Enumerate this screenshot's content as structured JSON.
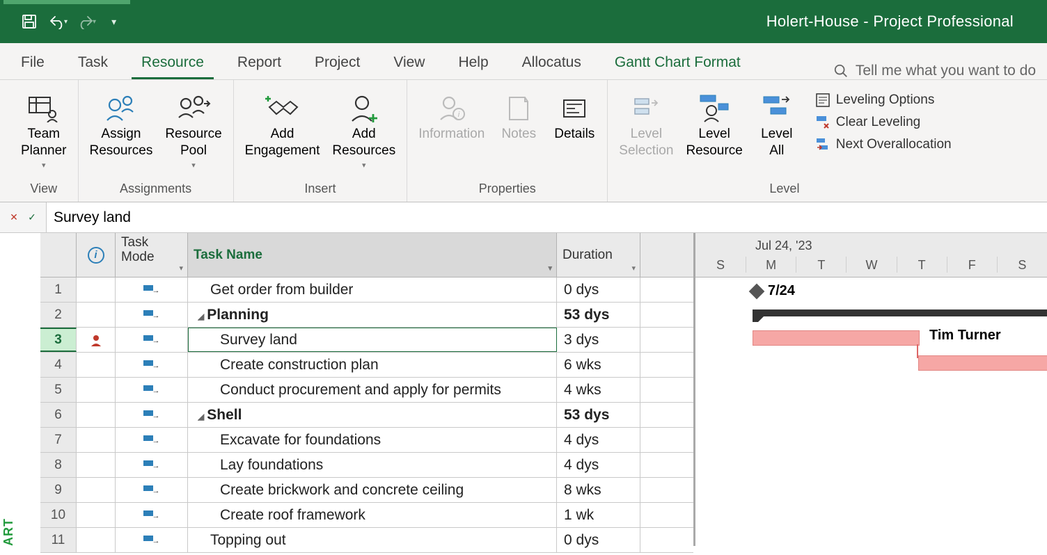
{
  "title": "Holert-House  -  Project Professional",
  "tabs": {
    "file": "File",
    "task": "Task",
    "resource": "Resource",
    "report": "Report",
    "project": "Project",
    "view": "View",
    "help": "Help",
    "allocatus": "Allocatus",
    "gantt_format": "Gantt Chart Format",
    "tell_me": "Tell me what you want to do"
  },
  "ribbon": {
    "team_planner": "Team\nPlanner",
    "assign_resources": "Assign\nResources",
    "resource_pool": "Resource\nPool",
    "add_engagement": "Add\nEngagement",
    "add_resources": "Add\nResources",
    "information": "Information",
    "notes": "Notes",
    "details": "Details",
    "level_selection": "Level\nSelection",
    "level_resource": "Level\nResource",
    "level_all": "Level\nAll",
    "leveling_options": "Leveling Options",
    "clear_leveling": "Clear Leveling",
    "next_overallocation": "Next Overallocation",
    "group_view": "View",
    "group_assignments": "Assignments",
    "group_insert": "Insert",
    "group_properties": "Properties",
    "group_level": "Level"
  },
  "formula_value": "Survey land",
  "columns": {
    "task_mode": "Task\nMode",
    "task_name": "Task Name",
    "duration": "Duration"
  },
  "rows": [
    {
      "num": "1",
      "name": "Get order from builder",
      "duration": "0 dys",
      "indent": 1,
      "bold": false,
      "outline": false,
      "info": ""
    },
    {
      "num": "2",
      "name": "Planning",
      "duration": "53 dys",
      "indent": 0,
      "bold": true,
      "outline": true,
      "info": ""
    },
    {
      "num": "3",
      "name": "Survey land",
      "duration": "3 dys",
      "indent": 2,
      "bold": false,
      "outline": false,
      "info": "person",
      "selected": true
    },
    {
      "num": "4",
      "name": "Create construction plan",
      "duration": "6 wks",
      "indent": 2,
      "bold": false,
      "outline": false,
      "info": ""
    },
    {
      "num": "5",
      "name": "Conduct procurement and apply for permits",
      "duration": "4 wks",
      "indent": 2,
      "bold": false,
      "outline": false,
      "info": ""
    },
    {
      "num": "6",
      "name": "Shell",
      "duration": "53 dys",
      "indent": 0,
      "bold": true,
      "outline": true,
      "info": ""
    },
    {
      "num": "7",
      "name": "Excavate for foundations",
      "duration": "4 dys",
      "indent": 2,
      "bold": false,
      "outline": false,
      "info": ""
    },
    {
      "num": "8",
      "name": "Lay foundations",
      "duration": "4 dys",
      "indent": 2,
      "bold": false,
      "outline": false,
      "info": ""
    },
    {
      "num": "9",
      "name": "Create brickwork and concrete ceiling",
      "duration": "8 wks",
      "indent": 2,
      "bold": false,
      "outline": false,
      "info": ""
    },
    {
      "num": "10",
      "name": "Create roof framework",
      "duration": "1 wk",
      "indent": 2,
      "bold": false,
      "outline": false,
      "info": ""
    },
    {
      "num": "11",
      "name": "Topping out",
      "duration": "0 dys",
      "indent": 1,
      "bold": false,
      "outline": false,
      "info": ""
    }
  ],
  "gantt": {
    "week_label": "Jul 24, '23",
    "days": [
      "S",
      "M",
      "T",
      "W",
      "T",
      "F",
      "S"
    ],
    "milestone_label": "7/24",
    "bar_label": "Tim Turner"
  },
  "vert_label": "ART"
}
